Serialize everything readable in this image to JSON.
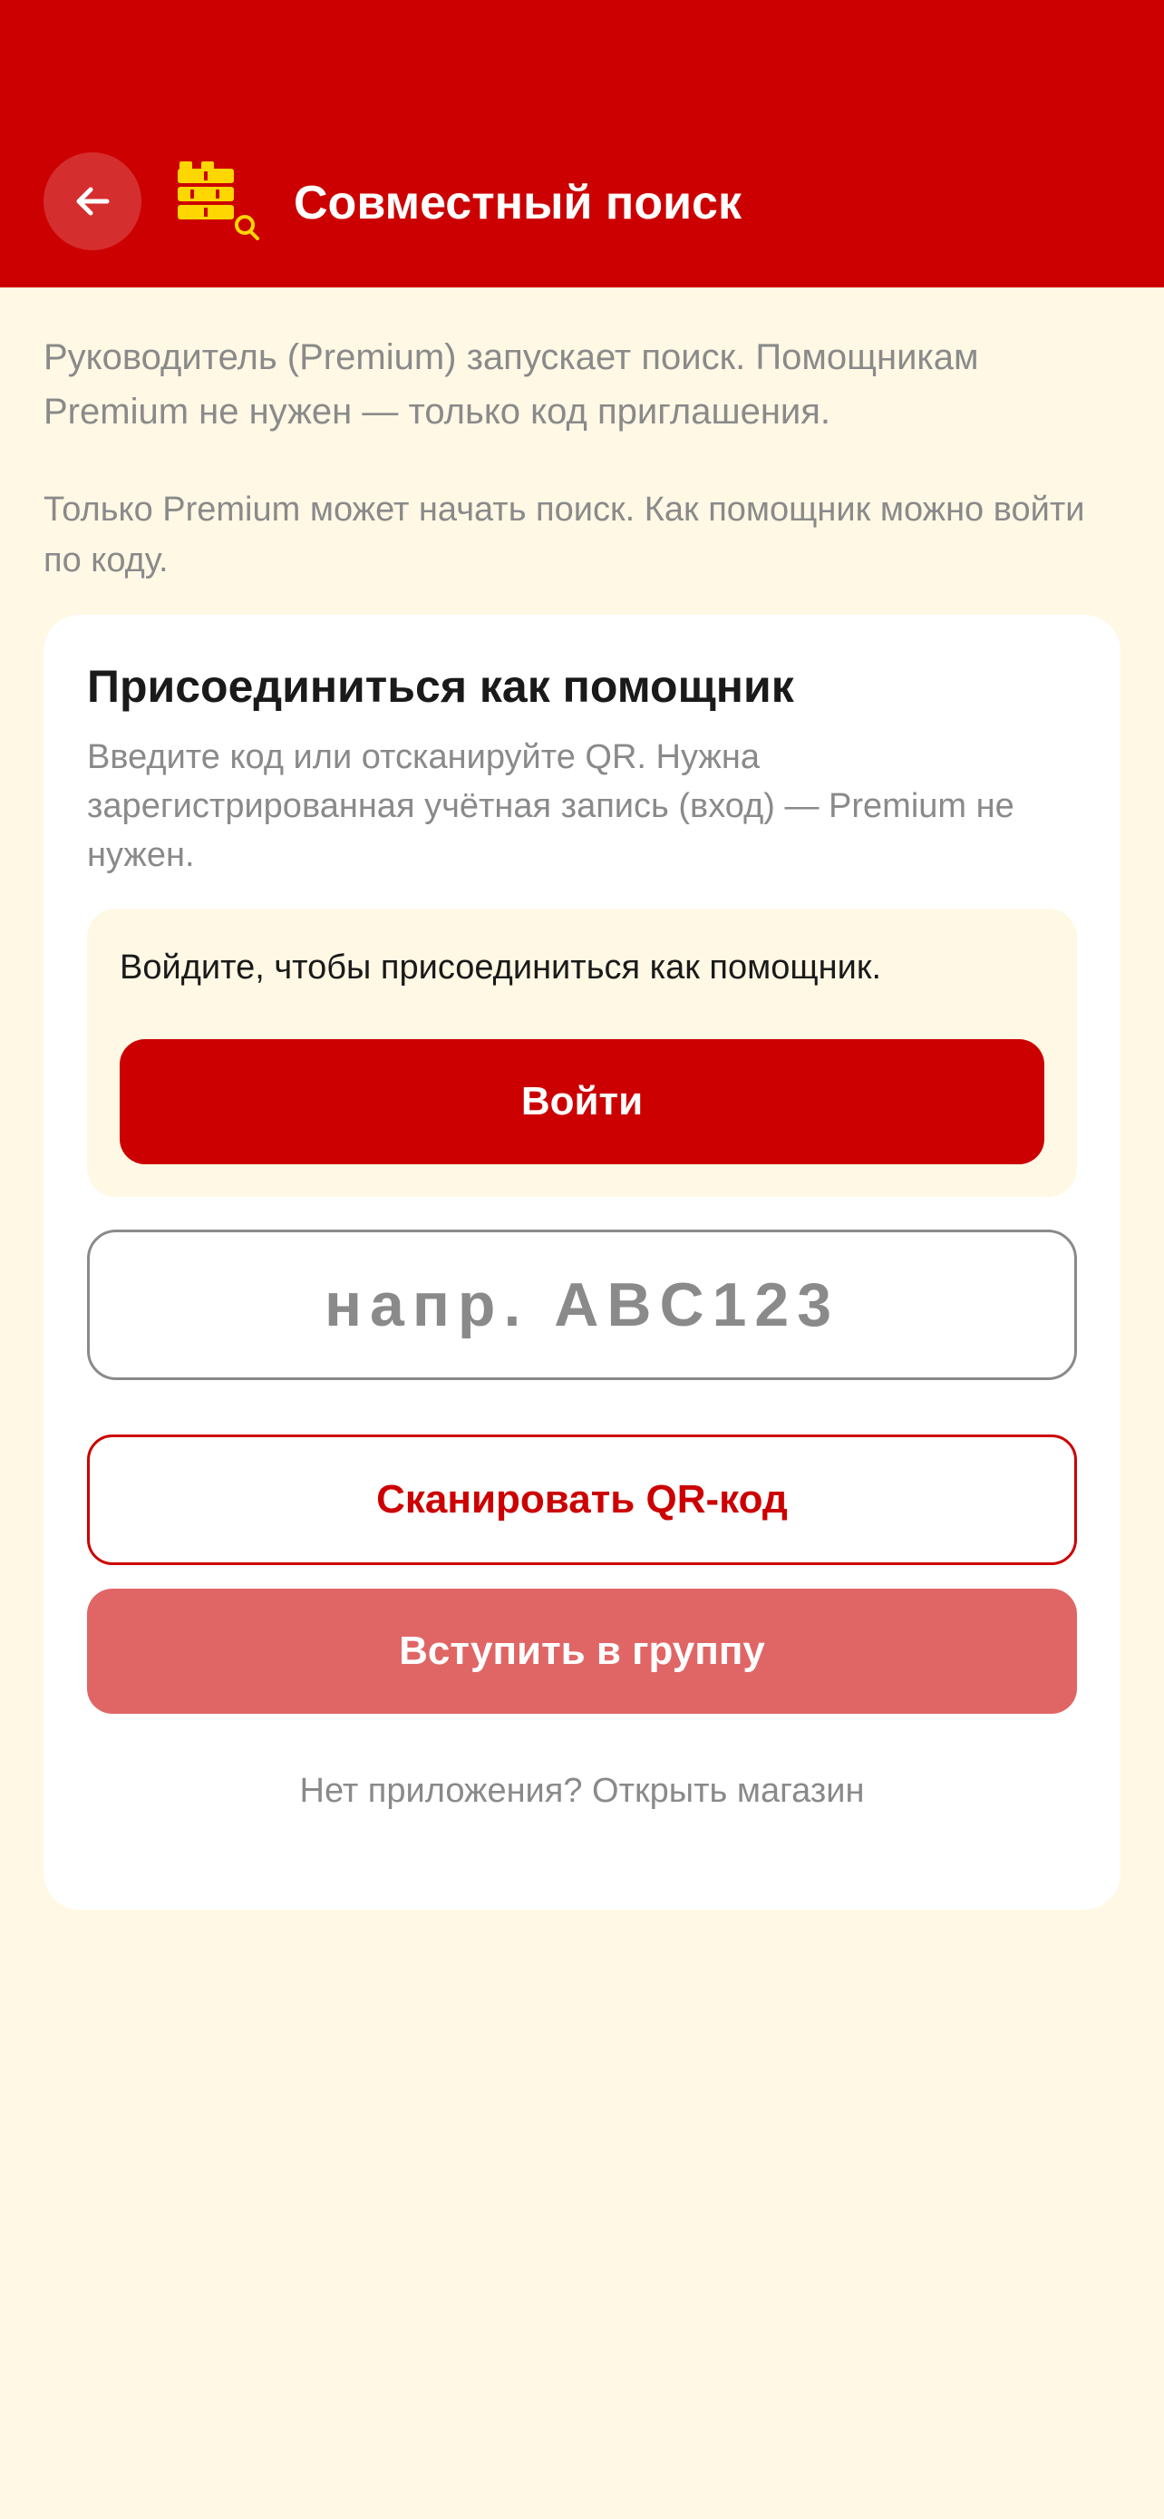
{
  "header": {
    "title": "Совместный поиск",
    "back_icon": "arrow-left-icon",
    "logo_icon": "brick-stack-search-logo",
    "background_color": "#CC0000"
  },
  "intro": {
    "text1": "Руководитель (Premium) запускает поиск. Помощникам Premium не нужен — только код приглашения.",
    "text2": "Только Premium может начать поиск. Как помощник можно войти по коду."
  },
  "join_card": {
    "title": "Присоединиться как помощник",
    "description": "Введите код или отсканируйте QR. Нужна зарегистрированная учётная запись (вход) — Premium не нужен.",
    "login_prompt": "Войдите, чтобы присоединиться как помощник.",
    "login_button": "Войти",
    "code_input": {
      "value": "",
      "placeholder": "напр. ABC123"
    },
    "scan_button": "Сканировать QR-код",
    "join_button": "Вступить в группу",
    "store_link": "Нет приложения? Открыть магазин"
  },
  "colors": {
    "brand_red": "#CC0000",
    "page_background": "#FFF8E5",
    "join_button_disabled": "#E06666",
    "logo_yellow": "#FFD700",
    "muted_text": "#8A8A8A"
  }
}
